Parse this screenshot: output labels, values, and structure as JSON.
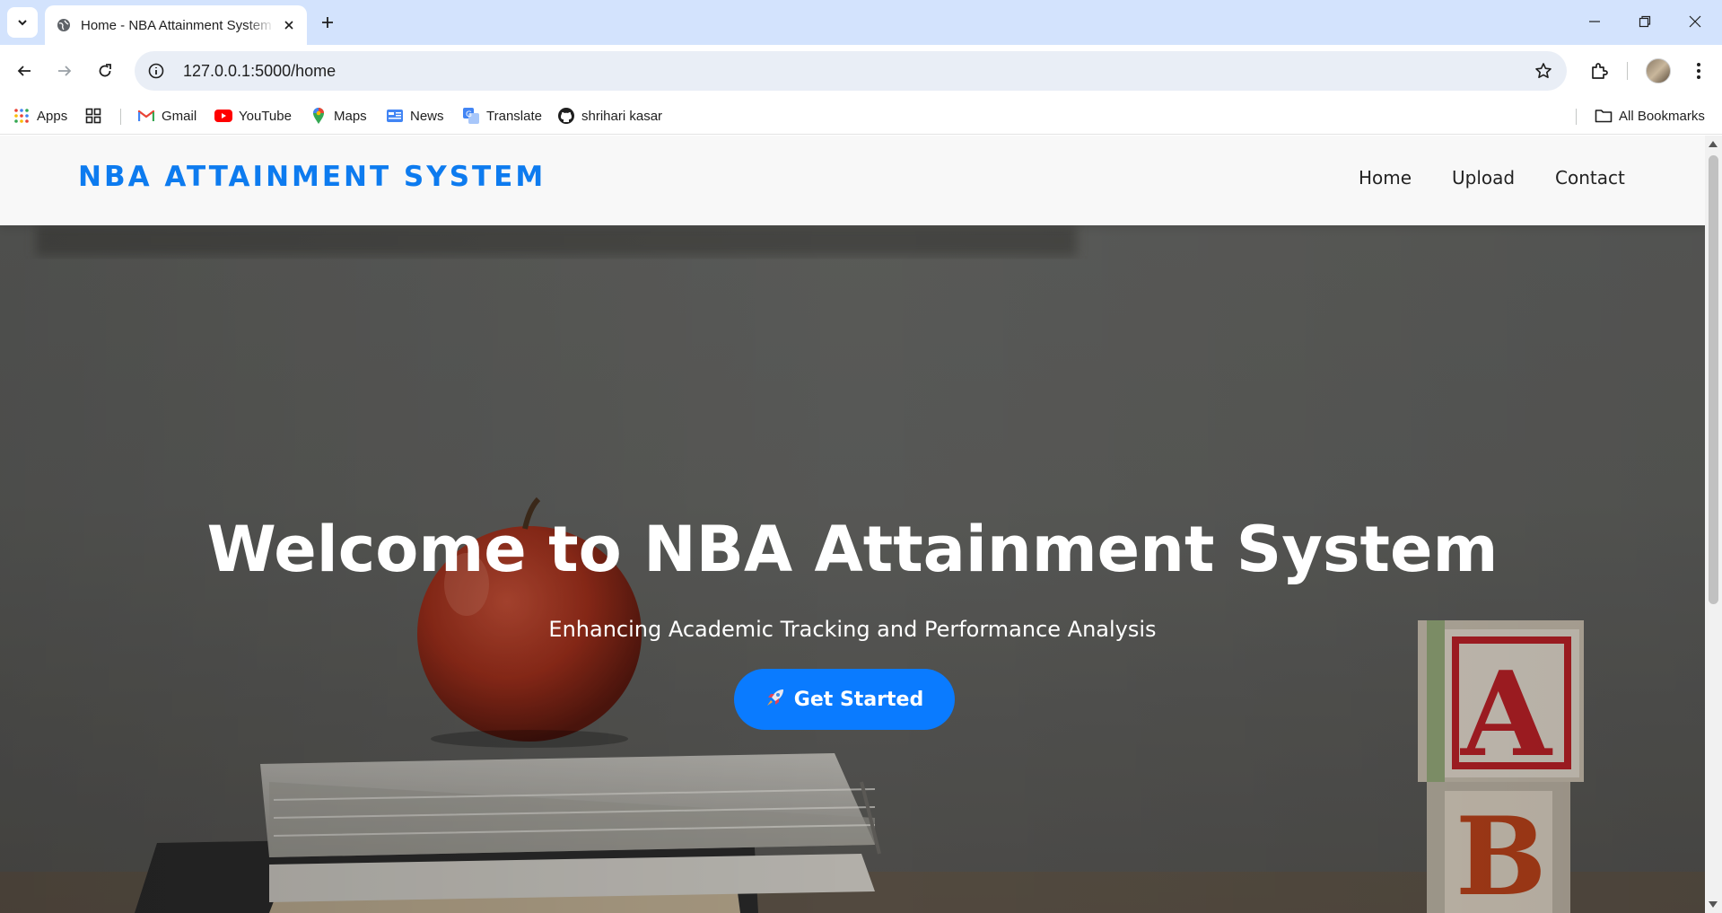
{
  "browser": {
    "tab_title": "Home - NBA Attainment System",
    "url": "127.0.0.1:5000/home",
    "bookmarks": [
      "Apps",
      "Gmail",
      "YouTube",
      "Maps",
      "News",
      "Translate",
      "shrihari kasar"
    ],
    "all_bookmarks_label": "All Bookmarks"
  },
  "site": {
    "brand": "NBA ATTAINMENT SYSTEM",
    "nav": [
      "Home",
      "Upload",
      "Contact"
    ],
    "hero": {
      "title": "Welcome to NBA Attainment System",
      "subtitle": "Enhancing Academic Tracking and Performance Analysis",
      "cta_label": "Get Started",
      "cta_icon": "rocket-icon",
      "background_image": "apple on stack of books with A B alphabet blocks"
    }
  },
  "colors": {
    "brand": "#0d7bef",
    "cta": "#0a7bff",
    "tabstrip": "#d3e3fd",
    "omnibox": "#e9eef6",
    "nav_bg": "#f8f8f8"
  }
}
